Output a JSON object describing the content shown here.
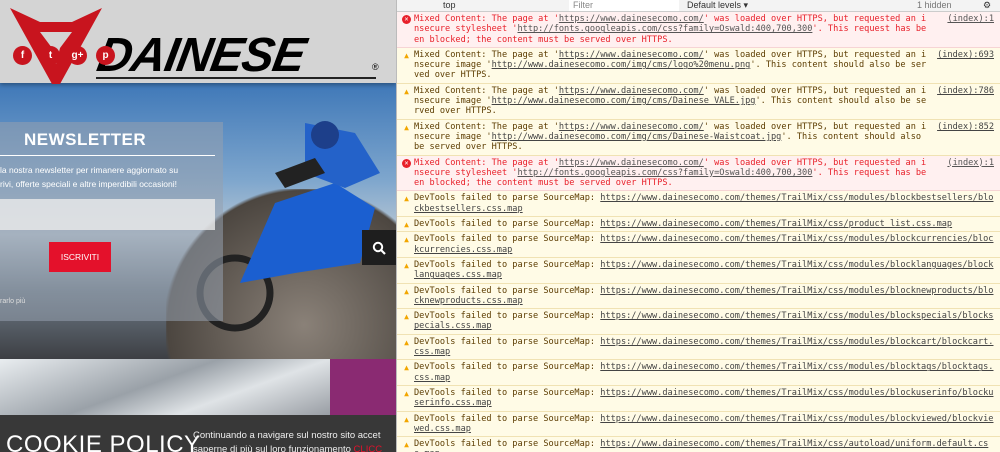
{
  "site": {
    "brand": "DAINESE",
    "social": [
      "f",
      "t",
      "g+",
      "p"
    ],
    "newsletter": {
      "title": "NEWSLETTER",
      "text_line1": "la nostra newsletter per rimanere aggiornato su",
      "text_line2": "rivi, offerte speciali e altre imperdibili occasioni!",
      "input_placeholder": "",
      "button": "ISCRIVITI",
      "more": "rarlo più"
    },
    "cookie": {
      "title": "COOKIE POLICY",
      "text_line1": "Continuando a navigare sul nostro sito accet",
      "text_line2": "saperne di più sul loro funzionamento ",
      "link": "CLICC"
    }
  },
  "devtools": {
    "toolbar": {
      "context": "top",
      "filter_placeholder": "Filter",
      "levels": "Default levels ▾",
      "hidden": "1 hidden"
    },
    "messages": [
      {
        "level": "error",
        "pre": "Mixed Content: The page at '",
        "url1": "https://www.dainesecomo.com/",
        "mid": "' was loaded over HTTPS, but requested an insecure stylesheet '",
        "url2": "http://fonts.googleapis.com/css?family=Oswald:400,700,300",
        "post": "'. This request has been blocked; the content must be served over HTTPS.",
        "source": "(index):1"
      },
      {
        "level": "warning",
        "pre": "Mixed Content: The page at '",
        "url1": "https://www.dainesecomo.com/",
        "mid": "' was loaded over HTTPS, but requested an insecure image '",
        "url2": "http://www.dainesecomo.com/img/cms/logo%20menu.png",
        "post": "'. This content should also be served over HTTPS.",
        "source": "(index):693"
      },
      {
        "level": "warning",
        "pre": "Mixed Content: The page at '",
        "url1": "https://www.dainesecomo.com/",
        "mid": "' was loaded over HTTPS, but requested an insecure image '",
        "url2": "http://www.dainesecomo.com/img/cms/Dainese_VALE.jpg",
        "post": "'. This content should also be served over HTTPS.",
        "source": "(index):786"
      },
      {
        "level": "warning",
        "pre": "Mixed Content: The page at '",
        "url1": "https://www.dainesecomo.com/",
        "mid": "' was loaded over HTTPS, but requested an insecure image '",
        "url2": "http://www.dainesecomo.com/img/cms/Dainese-Waistcoat.jpg",
        "post": "'. This content should also be served over HTTPS.",
        "source": "(index):852"
      },
      {
        "level": "error",
        "pre": "Mixed Content: The page at '",
        "url1": "https://www.dainesecomo.com/",
        "mid": "' was loaded over HTTPS, but requested an insecure stylesheet '",
        "url2": "http://fonts.googleapis.com/css?family=Oswald:400,700,300",
        "post": "'. This request has been blocked; the content must be served over HTTPS.",
        "source": "(index):1"
      }
    ],
    "sourcemap_prefix": "DevTools failed to parse SourceMap: ",
    "sourcemaps": [
      "https://www.dainesecomo.com/themes/TrailMix/css/modules/blockbestsellers/blockbestsellers.css.map",
      "https://www.dainesecomo.com/themes/TrailMix/css/product_list.css.map",
      "https://www.dainesecomo.com/themes/TrailMix/css/modules/blockcurrencies/blockcurrencies.css.map",
      "https://www.dainesecomo.com/themes/TrailMix/css/modules/blocklanguages/blocklanguages.css.map",
      "https://www.dainesecomo.com/themes/TrailMix/css/modules/blocknewproducts/blocknewproducts.css.map",
      "https://www.dainesecomo.com/themes/TrailMix/css/modules/blockspecials/blockspecials.css.map",
      "https://www.dainesecomo.com/themes/TrailMix/css/modules/blockcart/blockcart.css.map",
      "https://www.dainesecomo.com/themes/TrailMix/css/modules/blocktags/blocktags.css.map",
      "https://www.dainesecomo.com/themes/TrailMix/css/modules/blockuserinfo/blockuserinfo.css.map",
      "https://www.dainesecomo.com/themes/TrailMix/css/modules/blockviewed/blockviewed.css.map",
      "https://www.dainesecomo.com/themes/TrailMix/css/autoload/uniform.default.css.map"
    ]
  }
}
